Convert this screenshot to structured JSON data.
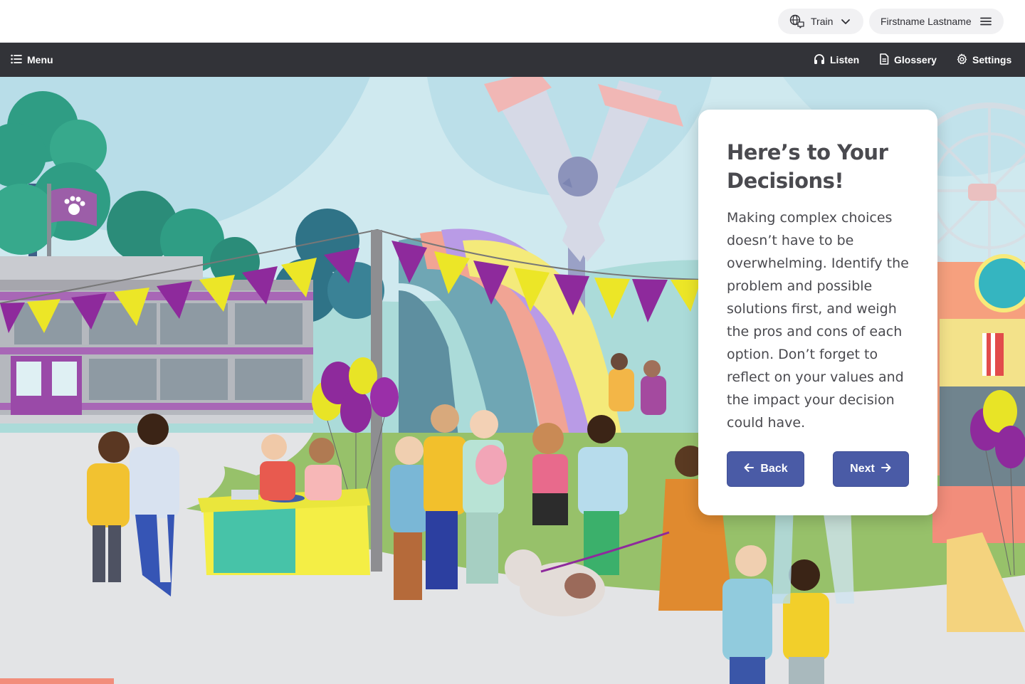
{
  "header": {
    "train_label": "Train",
    "user_name": "Firstname Lastname"
  },
  "nav": {
    "menu_label": "Menu",
    "listen_label": "Listen",
    "glossary_label": "Glossery",
    "settings_label": "Settings"
  },
  "dialog": {
    "title": "Here’s to Your Decisions!",
    "body": "Making complex choices doesn’t have to be overwhelming. Identify the problem and possible solutions first, and weigh the pros and cons of each option. Don’t forget to reflect on your values and the impact your decision could have.",
    "back_label": "Back",
    "next_label": "Next"
  },
  "icons": {
    "train": "globe-chat-icon",
    "train_trailing": "chevron-down-icon",
    "user_trailing": "hamburger-icon",
    "menu": "list-icon",
    "listen": "headphones-icon",
    "glossary": "document-icon",
    "settings": "gear-icon",
    "back": "arrow-left-icon",
    "next": "arrow-right-icon"
  },
  "colors": {
    "navbar": "#323338",
    "button": "#4a5ba6",
    "sky": "#cfe9ef",
    "grass": "#97c16a",
    "path": "#e3e4e6",
    "flag_purple": "#8e2a9c",
    "flag_yellow": "#ece627"
  }
}
